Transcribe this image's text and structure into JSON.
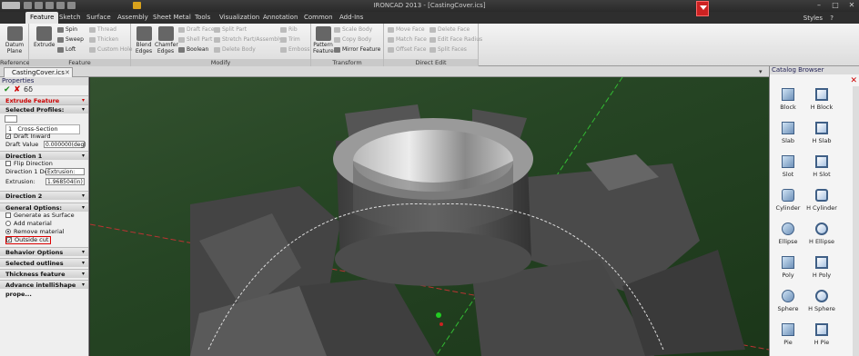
{
  "window": {
    "title": "IRONCAD 2013 - [CastingCover.ics]",
    "styles_label": "Styles",
    "help": "?"
  },
  "ribbon_tabs": [
    "Feature",
    "Sketch",
    "Surface",
    "Assembly",
    "Sheet Metal",
    "Tools",
    "Visualization",
    "Annotation",
    "Common",
    "Add-Ins"
  ],
  "ribbon": {
    "reference": {
      "label": "Reference",
      "datum": "Datum\nPlane"
    },
    "feature": {
      "label": "Feature",
      "extrude": "Extrude",
      "spin": "Spin",
      "sweep": "Sweep",
      "loft": "Loft",
      "thread": "Thread",
      "thicken": "Thicken",
      "custom_hole": "Custom Hole"
    },
    "modify": {
      "label": "Modify",
      "blend": "Blend\nEdges",
      "chamfer": "Chamfer\nEdges",
      "draft_faces": "Draft Faces",
      "shell_part": "Shell Part",
      "boolean": "Boolean",
      "split_part": "Split Part",
      "stretch": "Stretch Part/Assembly",
      "delete_body": "Delete Body",
      "rib": "Rib",
      "trim": "Trim",
      "emboss": "Emboss"
    },
    "transform": {
      "label": "Transform",
      "pattern": "Pattern\nFeature",
      "scale_body": "Scale Body",
      "copy_body": "Copy Body",
      "mirror_feature": "Mirror Feature"
    },
    "direct_edit": {
      "label": "Direct Edit",
      "move_face": "Move Face",
      "match_face": "Match Face",
      "offset_face": "Offset Face",
      "delete_face": "Delete Face",
      "edit_face_radius": "Edit Face Radius",
      "split_faces": "Split Faces"
    }
  },
  "document_tab": "CastingCover.ics",
  "properties": {
    "title": "Properties",
    "feature_title": "Extrude Feature",
    "sections": {
      "selected_profiles": "Selected Profiles:",
      "direction1": "Direction 1",
      "direction2": "Direction 2",
      "general": "General Options:",
      "behavior": "Behavior Options",
      "selected_outlines": "Selected outlines",
      "thickness": "Thickness feature",
      "advance": "Advance intelliShape prope..."
    },
    "profile_row": {
      "index": "1",
      "name": "Cross-Section"
    },
    "draft_inward": "Draft Inward",
    "draft_value_label": "Draft Value",
    "draft_value": "0.000000(deg)",
    "flip_direction": "Flip Direction",
    "dir1_label": "Direction 1 Dep...",
    "dir1_value": "Extrusion:",
    "extrusion_label": "Extrusion:",
    "extrusion_value": "1.968504(in)",
    "generate_surface": "Generate as Surface",
    "add_material": "Add material",
    "remove_material": "Remove material",
    "outside_cut": "Outside cut"
  },
  "catalog": {
    "title": "Catalog Browser",
    "items": [
      [
        "Block",
        "H Block"
      ],
      [
        "Slab",
        "H Slab"
      ],
      [
        "Slot",
        "H Slot"
      ],
      [
        "Cylinder",
        "H Cylinder"
      ],
      [
        "Ellipse",
        "H Ellipse"
      ],
      [
        "Poly",
        "H Poly"
      ],
      [
        "Sphere",
        "H Sphere"
      ],
      [
        "Pie",
        "H Pie"
      ]
    ]
  }
}
